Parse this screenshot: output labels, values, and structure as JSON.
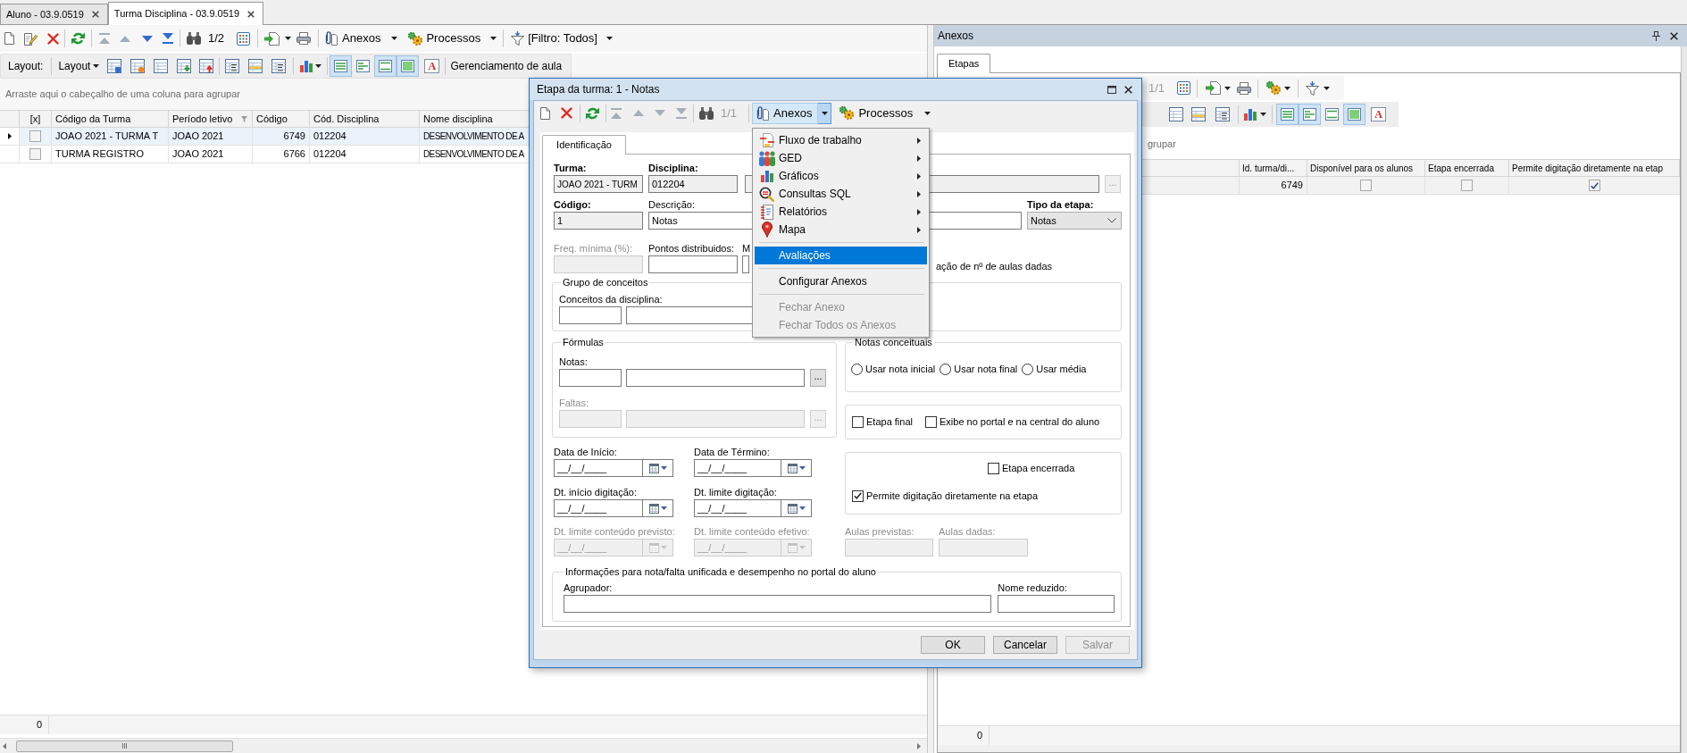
{
  "tabs": [
    {
      "label": "Aluno - 03.9.0519",
      "selected": false
    },
    {
      "label": "Turma Disciplina - 03.9.0519",
      "selected": true
    }
  ],
  "toolbar": {
    "navigation": [
      {
        "disabled": true
      },
      {
        "disabled": true
      },
      {
        "disabled": false
      },
      {
        "disabled": false
      }
    ],
    "page": "1/2",
    "attachments": "Anexos",
    "processes": "Processos",
    "filter": "[Filtro: Todos]"
  },
  "layout_bar": {
    "label": "Layout:",
    "layout_menu": "Layout",
    "view_toggles": [
      {
        "on": true
      },
      {
        "on": false
      },
      {
        "on": true
      },
      {
        "on": true
      }
    ],
    "font_button": "A",
    "class_management": "Gerenciamento de aula"
  },
  "group_hint": "Arraste aqui o cabeçalho de uma coluna para agrupar",
  "table": {
    "check_column": "[x]",
    "columns": [
      "Código da Turma",
      "Período letivo",
      "Código",
      "Cód. Disciplina",
      "Nome disciplina"
    ],
    "rows": [
      {
        "selected": true,
        "checked": false,
        "cells": [
          "JOAO 2021 - TURMA T",
          "JOAO 2021",
          "6749",
          "012204",
          "DESENVOLVIMENTO DE A"
        ]
      },
      {
        "selected": false,
        "checked": false,
        "cells": [
          "TURMA REGISTRO",
          "JOAO 2021",
          "6766",
          "012204",
          "DESENVOLVIMENTO DE A"
        ]
      }
    ]
  },
  "footer": {
    "count": "0"
  },
  "attachments_panel": {
    "title": "Anexos",
    "tabs": [
      {
        "label": "Etapas",
        "selected": true
      }
    ],
    "page": "1/1",
    "view_toggles": [
      {
        "on": true
      },
      {
        "on": true
      },
      {
        "on": false
      },
      {
        "on": true
      }
    ],
    "font_button": "A",
    "group_hint": "grupar",
    "columns": [
      "Id. turma/di...",
      "Disponível para os alunos",
      "Etapa encerrada",
      "Permite digitação diretamente na etap"
    ],
    "rows": [
      {
        "id": "6749",
        "available": false,
        "closed": false,
        "direct_entry": true
      }
    ],
    "count": "0"
  },
  "dialog": {
    "title": "Etapa da turma: 1 - Notas",
    "toolbar": {
      "navigation": [
        {
          "disabled": true
        },
        {
          "disabled": true
        },
        {
          "disabled": true
        },
        {
          "disabled": true
        }
      ],
      "page": "1/1",
      "attachments": "Anexos",
      "processes": "Processos",
      "attachments_open": true
    },
    "menu": {
      "items": [
        {
          "kind": "item",
          "label": "Fluxo de trabalho",
          "submenu": true,
          "selected": false,
          "disabled": false
        },
        {
          "kind": "item",
          "label": "GED",
          "submenu": true,
          "selected": false,
          "disabled": false
        },
        {
          "kind": "item",
          "label": "Gráficos",
          "submenu": true,
          "selected": false,
          "disabled": false
        },
        {
          "kind": "item",
          "label": "Consultas SQL",
          "submenu": true,
          "selected": false,
          "disabled": false
        },
        {
          "kind": "item",
          "label": "Relatórios",
          "submenu": true,
          "selected": false,
          "disabled": false
        },
        {
          "kind": "item",
          "label": "Mapa",
          "submenu": true,
          "selected": false,
          "disabled": false
        },
        {
          "kind": "separator"
        },
        {
          "kind": "item",
          "label": "Avaliações",
          "submenu": false,
          "selected": true,
          "disabled": false
        },
        {
          "kind": "separator"
        },
        {
          "kind": "item",
          "label": "Configurar Anexos",
          "submenu": false,
          "selected": false,
          "disabled": false
        },
        {
          "kind": "separator"
        },
        {
          "kind": "item",
          "label": "Fechar Anexo",
          "submenu": false,
          "selected": false,
          "disabled": true
        },
        {
          "kind": "item",
          "label": "Fechar Todos os Anexos",
          "submenu": false,
          "selected": false,
          "disabled": true
        }
      ]
    },
    "tabs": [
      {
        "label": "Identificação",
        "selected": true
      }
    ],
    "class": {
      "label": "Turma:",
      "value": "JOAO 2021 - TURM",
      "read_only": true
    },
    "subject": {
      "label": "Disciplina:",
      "value": "012204",
      "read_only": true
    },
    "subject_name": {
      "read_only": true
    },
    "subject_lookup": {
      "label": "...",
      "disabled": true
    },
    "code": {
      "label": "Código:",
      "value": "1",
      "read_only": true
    },
    "description": {
      "label": "Descrição:",
      "value": "Notas",
      "disabled": false
    },
    "stage_type": {
      "label": "Tipo da etapa:",
      "value": "Notas"
    },
    "min_frequency": {
      "label": "Freq. mínima (%):",
      "disabled": true
    },
    "points": {
      "label": "Pontos distribuidos:",
      "disabled": false
    },
    "field_5": {
      "label": "M"
    },
    "lessons_option_label": "ação de nº de aulas dadas",
    "concept_group": {
      "title": "Grupo de conceitos",
      "label": "Conceitos da disciplina:"
    },
    "formulas": {
      "title": "Fórmulas",
      "rows": [
        {
          "label": "Notas:",
          "button": "...",
          "disabled": false
        },
        {
          "label": "Faltas:",
          "button": "...",
          "disabled": true
        }
      ]
    },
    "concept_grades": {
      "title": "Notas conceituais",
      "options": [
        {
          "label": "Usar nota inicial",
          "selected": false
        },
        {
          "label": "Usar nota final",
          "selected": false
        },
        {
          "label": "Usar média",
          "selected": false
        }
      ]
    },
    "flags": [
      {
        "label": "Etapa final",
        "checked": false
      },
      {
        "label": "Exibe no portal e na central do aluno",
        "checked": false
      }
    ],
    "closed": {
      "label": "Etapa encerrada",
      "checked": false
    },
    "direct_entry": {
      "label": "Permite digitação diretamente na etapa",
      "checked": true
    },
    "dates": [
      {
        "label": "Data de Início:",
        "value": "__/__/____",
        "disabled": false
      },
      {
        "label": "Data de Término:",
        "value": "__/__/____",
        "disabled": false
      },
      {
        "label": "Dt. início digitação:",
        "value": "__/__/____",
        "disabled": false
      },
      {
        "label": "Dt. limite digitação:",
        "value": "__/__/____",
        "disabled": false
      },
      {
        "label": "Dt. limite conteúdo previsto:",
        "value": "__/__/____",
        "disabled": true
      },
      {
        "label": "Dt. limite conteúdo efetivo:",
        "value": "__/__/____",
        "disabled": true
      }
    ],
    "lessons": [
      {
        "label": "Aulas previstas:",
        "disabled": true
      },
      {
        "label": "Aulas dadas:",
        "disabled": true
      }
    ],
    "portal": {
      "title": "Informações para nota/falta unificada e desempenho no portal do aluno",
      "fields": [
        {
          "label": "Agrupador:"
        },
        {
          "label": "Nome reduzido:"
        }
      ]
    },
    "buttons": [
      {
        "label": "OK",
        "disabled": false
      },
      {
        "label": "Cancelar",
        "disabled": false
      },
      {
        "label": "Salvar",
        "disabled": true
      }
    ]
  }
}
